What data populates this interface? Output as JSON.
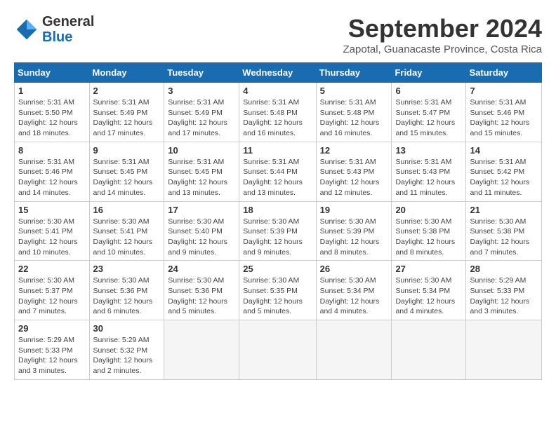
{
  "header": {
    "logo_general": "General",
    "logo_blue": "Blue",
    "month_title": "September 2024",
    "subtitle": "Zapotal, Guanacaste Province, Costa Rica"
  },
  "weekdays": [
    "Sunday",
    "Monday",
    "Tuesday",
    "Wednesday",
    "Thursday",
    "Friday",
    "Saturday"
  ],
  "weeks": [
    [
      {
        "day": "1",
        "sunrise": "5:31 AM",
        "sunset": "5:50 PM",
        "daylight": "12 hours and 18 minutes."
      },
      {
        "day": "2",
        "sunrise": "5:31 AM",
        "sunset": "5:49 PM",
        "daylight": "12 hours and 17 minutes."
      },
      {
        "day": "3",
        "sunrise": "5:31 AM",
        "sunset": "5:49 PM",
        "daylight": "12 hours and 17 minutes."
      },
      {
        "day": "4",
        "sunrise": "5:31 AM",
        "sunset": "5:48 PM",
        "daylight": "12 hours and 16 minutes."
      },
      {
        "day": "5",
        "sunrise": "5:31 AM",
        "sunset": "5:48 PM",
        "daylight": "12 hours and 16 minutes."
      },
      {
        "day": "6",
        "sunrise": "5:31 AM",
        "sunset": "5:47 PM",
        "daylight": "12 hours and 15 minutes."
      },
      {
        "day": "7",
        "sunrise": "5:31 AM",
        "sunset": "5:46 PM",
        "daylight": "12 hours and 15 minutes."
      }
    ],
    [
      {
        "day": "8",
        "sunrise": "5:31 AM",
        "sunset": "5:46 PM",
        "daylight": "12 hours and 14 minutes."
      },
      {
        "day": "9",
        "sunrise": "5:31 AM",
        "sunset": "5:45 PM",
        "daylight": "12 hours and 14 minutes."
      },
      {
        "day": "10",
        "sunrise": "5:31 AM",
        "sunset": "5:45 PM",
        "daylight": "12 hours and 13 minutes."
      },
      {
        "day": "11",
        "sunrise": "5:31 AM",
        "sunset": "5:44 PM",
        "daylight": "12 hours and 13 minutes."
      },
      {
        "day": "12",
        "sunrise": "5:31 AM",
        "sunset": "5:43 PM",
        "daylight": "12 hours and 12 minutes."
      },
      {
        "day": "13",
        "sunrise": "5:31 AM",
        "sunset": "5:43 PM",
        "daylight": "12 hours and 11 minutes."
      },
      {
        "day": "14",
        "sunrise": "5:31 AM",
        "sunset": "5:42 PM",
        "daylight": "12 hours and 11 minutes."
      }
    ],
    [
      {
        "day": "15",
        "sunrise": "5:30 AM",
        "sunset": "5:41 PM",
        "daylight": "12 hours and 10 minutes."
      },
      {
        "day": "16",
        "sunrise": "5:30 AM",
        "sunset": "5:41 PM",
        "daylight": "12 hours and 10 minutes."
      },
      {
        "day": "17",
        "sunrise": "5:30 AM",
        "sunset": "5:40 PM",
        "daylight": "12 hours and 9 minutes."
      },
      {
        "day": "18",
        "sunrise": "5:30 AM",
        "sunset": "5:39 PM",
        "daylight": "12 hours and 9 minutes."
      },
      {
        "day": "19",
        "sunrise": "5:30 AM",
        "sunset": "5:39 PM",
        "daylight": "12 hours and 8 minutes."
      },
      {
        "day": "20",
        "sunrise": "5:30 AM",
        "sunset": "5:38 PM",
        "daylight": "12 hours and 8 minutes."
      },
      {
        "day": "21",
        "sunrise": "5:30 AM",
        "sunset": "5:38 PM",
        "daylight": "12 hours and 7 minutes."
      }
    ],
    [
      {
        "day": "22",
        "sunrise": "5:30 AM",
        "sunset": "5:37 PM",
        "daylight": "12 hours and 7 minutes."
      },
      {
        "day": "23",
        "sunrise": "5:30 AM",
        "sunset": "5:36 PM",
        "daylight": "12 hours and 6 minutes."
      },
      {
        "day": "24",
        "sunrise": "5:30 AM",
        "sunset": "5:36 PM",
        "daylight": "12 hours and 5 minutes."
      },
      {
        "day": "25",
        "sunrise": "5:30 AM",
        "sunset": "5:35 PM",
        "daylight": "12 hours and 5 minutes."
      },
      {
        "day": "26",
        "sunrise": "5:30 AM",
        "sunset": "5:34 PM",
        "daylight": "12 hours and 4 minutes."
      },
      {
        "day": "27",
        "sunrise": "5:30 AM",
        "sunset": "5:34 PM",
        "daylight": "12 hours and 4 minutes."
      },
      {
        "day": "28",
        "sunrise": "5:29 AM",
        "sunset": "5:33 PM",
        "daylight": "12 hours and 3 minutes."
      }
    ],
    [
      {
        "day": "29",
        "sunrise": "5:29 AM",
        "sunset": "5:33 PM",
        "daylight": "12 hours and 3 minutes."
      },
      {
        "day": "30",
        "sunrise": "5:29 AM",
        "sunset": "5:32 PM",
        "daylight": "12 hours and 2 minutes."
      },
      null,
      null,
      null,
      null,
      null
    ]
  ]
}
